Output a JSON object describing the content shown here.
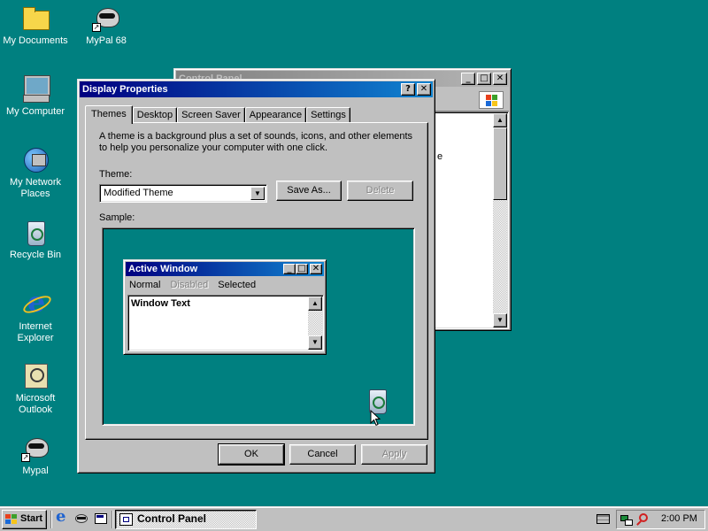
{
  "desktop": {
    "icons": [
      {
        "label": "My Documents",
        "icon": "folder-icon"
      },
      {
        "label": "MyPal 68",
        "icon": "raccoon-icon"
      },
      {
        "label": "My Computer",
        "icon": "computer-icon"
      },
      {
        "label": "My Network Places",
        "icon": "network-icon"
      },
      {
        "label": "Recycle Bin",
        "icon": "recycle-bin-icon"
      },
      {
        "label": "Internet Explorer",
        "icon": "ie-icon"
      },
      {
        "label": "Microsoft Outlook",
        "icon": "outlook-icon"
      },
      {
        "label": "Mypal",
        "icon": "raccoon-icon"
      }
    ]
  },
  "control_panel": {
    "title": "Control Panel",
    "list_fragment": "e"
  },
  "display_properties": {
    "title": "Display Properties",
    "tabs": [
      "Themes",
      "Desktop",
      "Screen Saver",
      "Appearance",
      "Settings"
    ],
    "selected_tab": "Themes",
    "description": "A theme is a background plus a set of sounds, icons, and other elements to help you personalize your computer with one click.",
    "theme_label": "Theme:",
    "theme_value": "Modified Theme",
    "save_as_label": "Save As...",
    "delete_label": "Delete",
    "sample_label": "Sample:",
    "sample": {
      "window_title": "Active Window",
      "menu_normal": "Normal",
      "menu_disabled": "Disabled",
      "menu_selected": "Selected",
      "window_text": "Window Text"
    },
    "ok_label": "OK",
    "cancel_label": "Cancel",
    "apply_label": "Apply"
  },
  "taskbar": {
    "start_label": "Start",
    "task_label": "Control Panel",
    "clock": "2:00 PM"
  },
  "colors": {
    "desktop": "#008080",
    "active_title": "#000080",
    "face": "#c0c0c0"
  }
}
